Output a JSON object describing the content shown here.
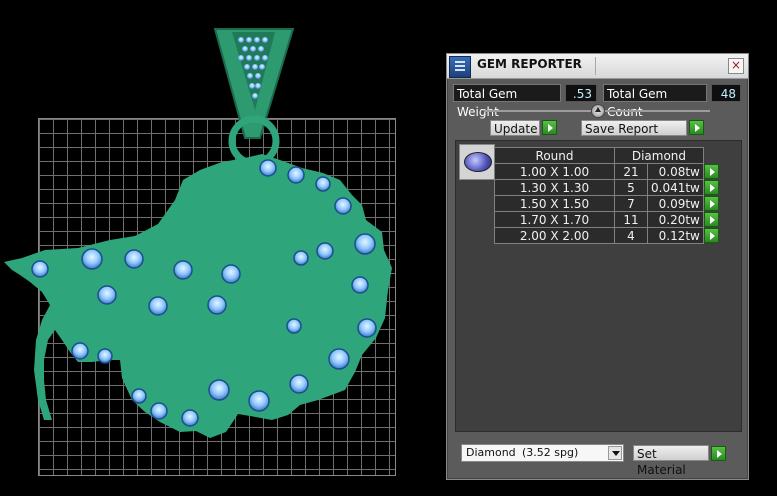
{
  "panel": {
    "title": "GEM REPORTER",
    "close_label": "×",
    "total_weight_label": "Total Gem Weight",
    "total_weight_value": ".53",
    "total_count_label": "Total Gem Count",
    "total_count_value": "48",
    "update_label": "Update",
    "save_report_label": "Save Report",
    "set_material_label": "Set Material"
  },
  "table": {
    "shape_header": "Round",
    "material_header": "Diamond",
    "rows": [
      {
        "size": "1.00 X 1.00",
        "count": "21",
        "weight": "0.08tw"
      },
      {
        "size": "1.30 X 1.30",
        "count": "5",
        "weight": "0.041tw"
      },
      {
        "size": "1.50 X 1.50",
        "count": "7",
        "weight": "0.09tw"
      },
      {
        "size": "1.70 X 1.70",
        "count": "11",
        "weight": "0.20tw"
      },
      {
        "size": "2.00 X 2.00",
        "count": "4",
        "weight": "0.12tw"
      }
    ]
  },
  "material_select": {
    "name": "Diamond",
    "spg": "(3.52 spg)"
  },
  "colors": {
    "model_green": "#2fa57c",
    "gem_blue": "#8fc8ff",
    "accent_green": "#3aa52e"
  }
}
